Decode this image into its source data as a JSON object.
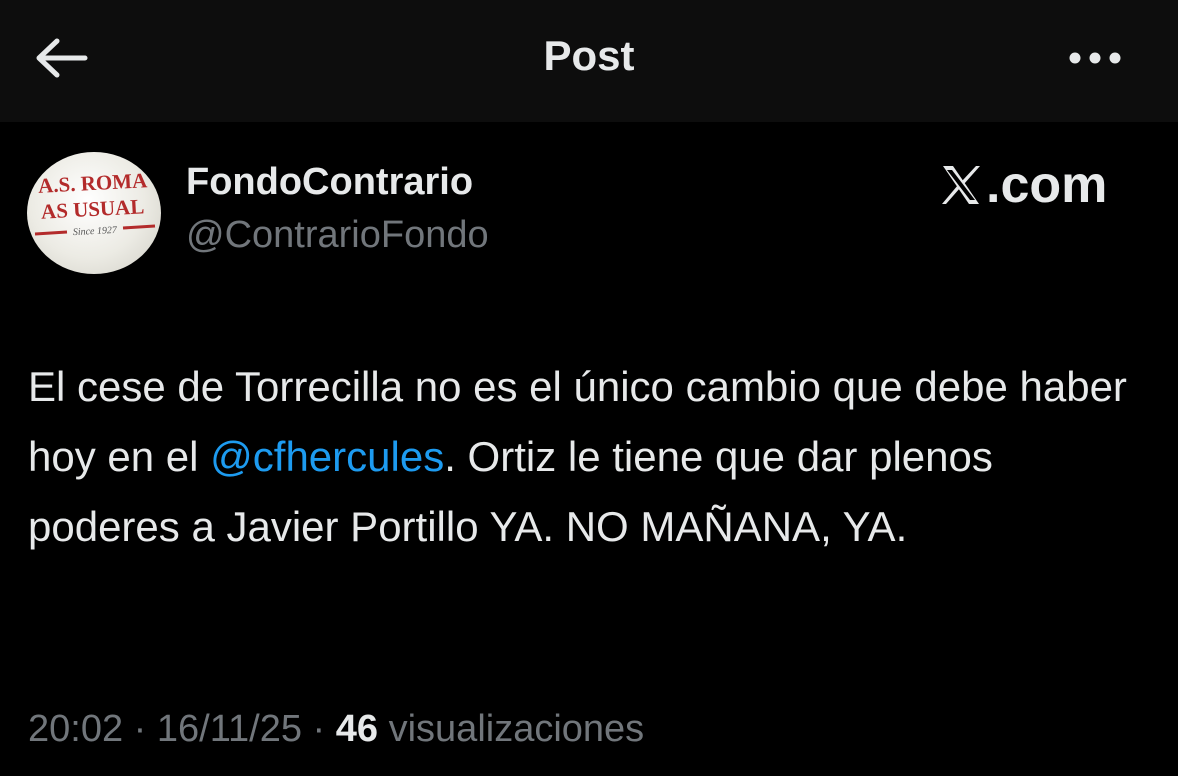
{
  "header": {
    "title": "Post",
    "back_icon": "arrow-left-icon",
    "more_icon": "more-horizontal-icon"
  },
  "author": {
    "name": "FondoContrario",
    "handle": "@ContrarioFondo",
    "avatar_line1": "A.S. ROMA",
    "avatar_line2": "AS USUAL",
    "avatar_line3": "Since 1927"
  },
  "source_badge": {
    "logo_icon": "x-logo-icon",
    "domain": ".com"
  },
  "tweet": {
    "text_before": "El cese de Torrecilla no es el único cambio que debe haber hoy en el ",
    "mention": "@cfhercules",
    "text_after": ".  Ortiz le tiene que dar plenos poderes a Javier Portillo YA. NO MAÑANA,  YA."
  },
  "meta": {
    "time": "20:02",
    "sep1": " · ",
    "date": "16/11/25",
    "sep2": " · ",
    "views_count": "46",
    "views_label": " visualizaciones"
  },
  "colors": {
    "background": "#000000",
    "header_bg": "#0d0d0d",
    "text": "#e7e9ea",
    "secondary": "#71767b",
    "link": "#1d9bf0",
    "avatar_red": "#b32b2b"
  }
}
